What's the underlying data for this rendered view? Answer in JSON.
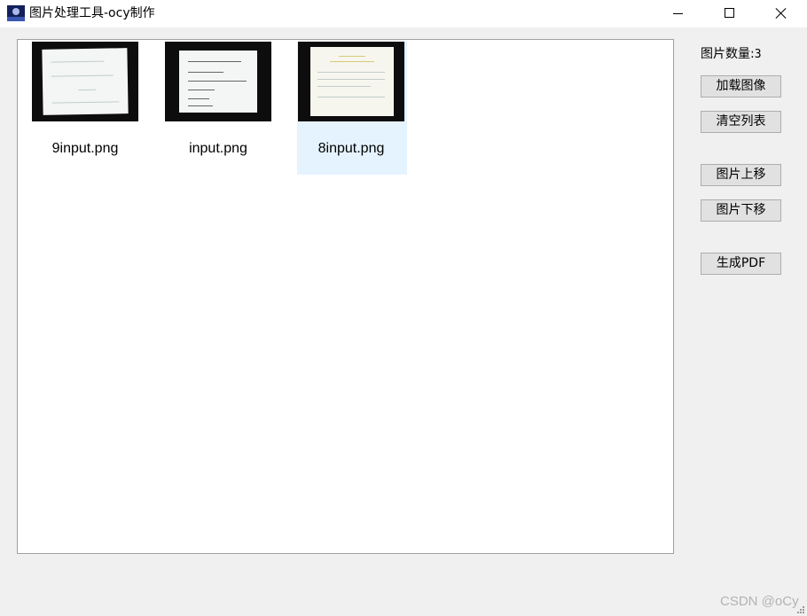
{
  "window": {
    "title": "图片处理工具-ocy制作",
    "icon": "app-icon",
    "controls": [
      "minimize-icon",
      "maximize-icon",
      "close-icon"
    ]
  },
  "image_list": {
    "items": [
      {
        "label": "9input.png",
        "selected": false
      },
      {
        "label": "input.png",
        "selected": false
      },
      {
        "label": "8input.png",
        "selected": true
      }
    ]
  },
  "side_panel": {
    "count_label": "图片数量:",
    "count_value": "3",
    "buttons": {
      "load": "加载图像",
      "clear": "清空列表",
      "move_up": "图片上移",
      "move_down": "图片下移",
      "generate_pdf": "生成PDF"
    }
  },
  "watermark": "CSDN @oCy",
  "colors": {
    "selection": "#e5f3ff",
    "button_bg": "#e1e1e1",
    "window_bg": "#f0f0f0"
  }
}
